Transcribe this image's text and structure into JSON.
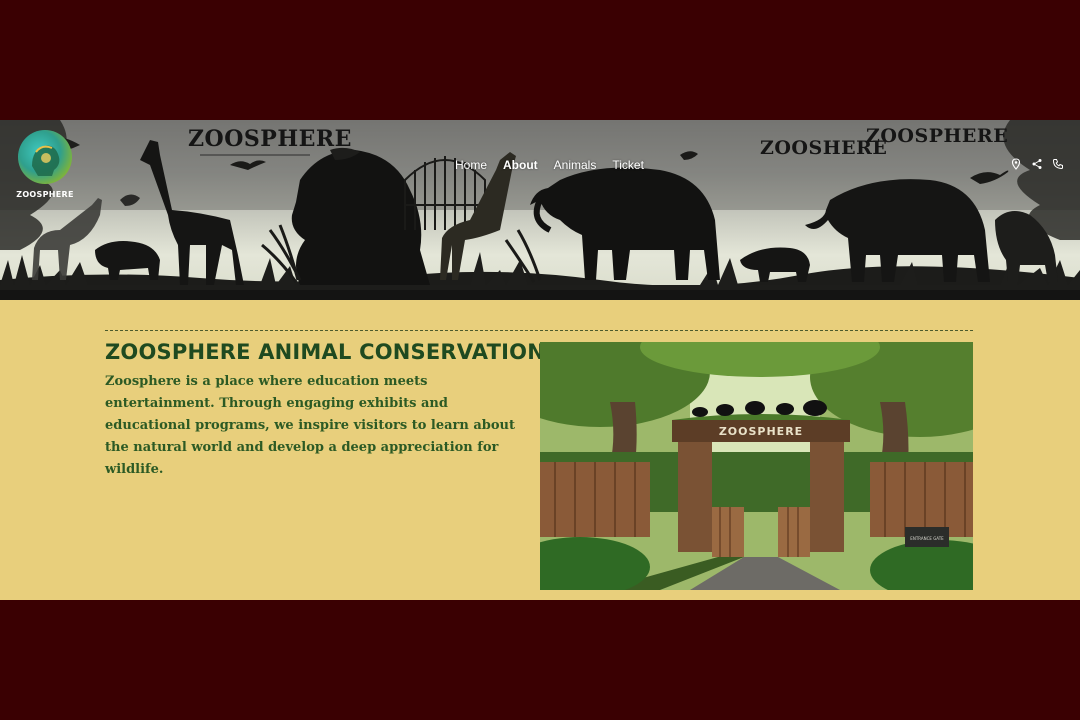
{
  "header": {
    "logo_text": "ZOOSPHERE",
    "brand_texts": [
      "ZOOSPHERE",
      "ZOOSHERE",
      "ZOOSPHERE"
    ],
    "nav": {
      "items": [
        {
          "label": "Home",
          "active": false
        },
        {
          "label": "About",
          "active": true
        },
        {
          "label": "Animals",
          "active": false
        },
        {
          "label": "Ticket",
          "active": false
        }
      ]
    },
    "icons": [
      "location-pin-icon",
      "share-icon",
      "phone-icon"
    ]
  },
  "main": {
    "title": "Zoosphere Animal Conservation",
    "description": "Zoosphere is a place where education meets entertainment. Through engaging exhibits and educational programs, we inspire visitors to learn about the natural world and develop a deep appreciation for wildlife.",
    "image": {
      "sign_text": "ZOOSPHERE",
      "plaque_text": "ENTRANCE GATE"
    }
  },
  "colors": {
    "outer_background": "#3a0002",
    "content_background": "#e8cf7c",
    "title_color": "#1f4a20",
    "text_color": "#2c5a24"
  }
}
